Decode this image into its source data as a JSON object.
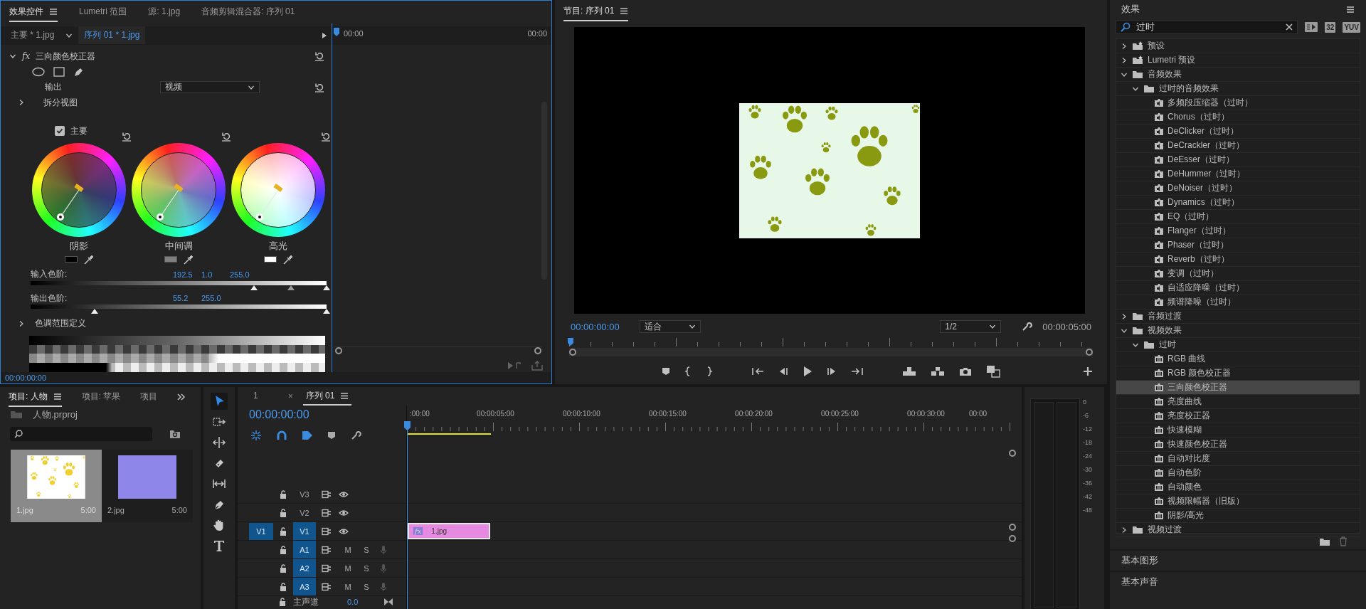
{
  "effect_controls": {
    "tabs": [
      {
        "label": "效果控件",
        "selected": true
      },
      {
        "label": "Lumetri 范围",
        "selected": false
      },
      {
        "label": "源: 1.jpg",
        "selected": false
      },
      {
        "label": "音频剪辑混合器: 序列 01",
        "selected": false
      }
    ],
    "clip_tabs": [
      {
        "label": "主要 * 1.jpg",
        "selected": false
      },
      {
        "label": "序列 01 * 1.jpg",
        "selected": true
      }
    ],
    "ruler_labels": [
      "00:00",
      "00:00"
    ],
    "effect": {
      "badge": "fx",
      "name": "三向颜色校正器",
      "expanded": true
    },
    "output": {
      "label": "输出",
      "value": "视频"
    },
    "split_view": {
      "label": "拆分视图",
      "expanded": false
    },
    "master": {
      "label": "主要",
      "checked": true
    },
    "wheels": [
      {
        "label": "阴影",
        "kind": "shadows"
      },
      {
        "label": "中间调",
        "kind": "midtones"
      },
      {
        "label": "高光",
        "kind": "highlights"
      }
    ],
    "input_levels": {
      "label": "输入色阶:",
      "values": [
        "192.5",
        "1.0",
        "255.0"
      ],
      "handles": [
        {
          "level": 0.755
        },
        {
          "level": 0.88
        },
        {
          "level": 1
        }
      ]
    },
    "output_levels": {
      "label": "输出色阶:",
      "values": [
        "55.2",
        "255.0"
      ],
      "handles": [
        {
          "level": 0.216
        },
        {
          "level": 1
        }
      ]
    },
    "tonal_range": {
      "label": "色调范围定义",
      "expanded": false
    },
    "timecode": "00:00:00:00"
  },
  "program_monitor": {
    "title": "节目: 序列 01",
    "timecode": "00:00:00:00",
    "zoom": "适合",
    "resolution": "1/2",
    "duration": "00:00:05:00"
  },
  "effects": {
    "title": "效果",
    "search": "过时",
    "badges": [
      "32",
      "YUV"
    ],
    "tree": [
      {
        "label": "预设",
        "kind": "preset_folder",
        "expanded": false,
        "selected": false
      },
      {
        "label": "Lumetri 预设",
        "kind": "preset_folder",
        "expanded": false,
        "selected": false
      },
      {
        "label": "音频效果",
        "kind": "folder",
        "expanded": true,
        "selected": false,
        "children": [
          {
            "label": "过时的音频效果",
            "kind": "folder",
            "expanded": true,
            "selected": false,
            "children": [
              {
                "label": "多频段压缩器（过时）",
                "kind": "audio_effect",
                "selected": false
              },
              {
                "label": "Chorus（过时）",
                "kind": "audio_effect",
                "selected": false
              },
              {
                "label": "DeClicker（过时）",
                "kind": "audio_effect",
                "selected": false
              },
              {
                "label": "DeCrackler（过时）",
                "kind": "audio_effect",
                "selected": false
              },
              {
                "label": "DeEsser（过时）",
                "kind": "audio_effect",
                "selected": false
              },
              {
                "label": "DeHummer（过时）",
                "kind": "audio_effect",
                "selected": false
              },
              {
                "label": "DeNoiser（过时）",
                "kind": "audio_effect",
                "selected": false
              },
              {
                "label": "Dynamics（过时）",
                "kind": "audio_effect",
                "selected": false
              },
              {
                "label": "EQ（过时）",
                "kind": "audio_effect",
                "selected": false
              },
              {
                "label": "Flanger（过时）",
                "kind": "audio_effect",
                "selected": false
              },
              {
                "label": "Phaser（过时）",
                "kind": "audio_effect",
                "selected": false
              },
              {
                "label": "Reverb（过时）",
                "kind": "audio_effect",
                "selected": false
              },
              {
                "label": "变调（过时）",
                "kind": "audio_effect",
                "selected": false
              },
              {
                "label": "自适应降噪（过时）",
                "kind": "audio_effect",
                "selected": false
              },
              {
                "label": "频谱降噪（过时）",
                "kind": "audio_effect",
                "selected": false
              }
            ]
          }
        ]
      },
      {
        "label": "音频过渡",
        "kind": "folder",
        "expanded": false,
        "selected": false
      },
      {
        "label": "视频效果",
        "kind": "folder",
        "expanded": true,
        "selected": false,
        "children": [
          {
            "label": "过时",
            "kind": "folder",
            "expanded": true,
            "selected": false,
            "children": [
              {
                "label": "RGB 曲线",
                "kind": "video_effect",
                "selected": false
              },
              {
                "label": "RGB 颜色校正器",
                "kind": "video_effect",
                "selected": false
              },
              {
                "label": "三向颜色校正器",
                "kind": "video_effect",
                "selected": true
              },
              {
                "label": "亮度曲线",
                "kind": "video_effect",
                "selected": false
              },
              {
                "label": "亮度校正器",
                "kind": "video_effect",
                "selected": false
              },
              {
                "label": "快速模糊",
                "kind": "video_effect",
                "selected": false
              },
              {
                "label": "快速颜色校正器",
                "kind": "video_effect",
                "selected": false
              },
              {
                "label": "自动对比度",
                "kind": "video_effect",
                "selected": false
              },
              {
                "label": "自动色阶",
                "kind": "video_effect",
                "selected": false
              },
              {
                "label": "自动颜色",
                "kind": "video_effect",
                "selected": false
              },
              {
                "label": "视频限幅器（旧版）",
                "kind": "video_effect",
                "selected": false
              },
              {
                "label": "阴影/高光",
                "kind": "video_effect",
                "selected": false
              }
            ]
          }
        ]
      },
      {
        "label": "视频过渡",
        "kind": "folder",
        "expanded": false,
        "selected": false
      }
    ],
    "sections": [
      "基本图形",
      "基本声音"
    ]
  },
  "project": {
    "tabs": [
      {
        "label": "项目: 人物",
        "selected": true
      },
      {
        "label": "项目: 苹果",
        "selected": false
      },
      {
        "label": "项目",
        "selected": false
      }
    ],
    "file": "人物.prproj",
    "items": [
      {
        "name": "1.jpg",
        "duration": "5:00",
        "kind": "paws",
        "selected": true
      },
      {
        "name": "2.jpg",
        "duration": "5:00",
        "kind": "solid",
        "selected": false
      }
    ]
  },
  "tools": [
    {
      "kind": "selection",
      "selected": true
    },
    {
      "kind": "track_select",
      "selected": false
    },
    {
      "kind": "ripple",
      "selected": false
    },
    {
      "kind": "razor",
      "selected": false
    },
    {
      "kind": "slip",
      "selected": false
    },
    {
      "kind": "pen",
      "selected": false
    },
    {
      "kind": "hand",
      "selected": false
    },
    {
      "kind": "type",
      "selected": false
    }
  ],
  "timeline": {
    "tabs": [
      {
        "label": "1",
        "selected": false,
        "closable": false
      },
      {
        "label": "序列 01",
        "selected": true,
        "closable": true
      }
    ],
    "close": "×",
    "timecode": "00:00:00:00",
    "ruler": [
      ":00:00",
      "00:00:05:00",
      "00:00:10:00",
      "00:00:15:00",
      "00:00:20:00",
      "00:00:25:00",
      "00:00:30:00",
      "00:00"
    ],
    "tracks": [
      {
        "name": "V3",
        "kind": "video",
        "targeted": false
      },
      {
        "name": "V2",
        "kind": "video",
        "targeted": false
      },
      {
        "name": "V1",
        "kind": "video",
        "targeted": true,
        "source": "V1"
      },
      {
        "name": "A1",
        "kind": "audio",
        "targeted": true,
        "mute": "M",
        "solo": "S"
      },
      {
        "name": "A2",
        "kind": "audio",
        "targeted": true,
        "mute": "M",
        "solo": "S"
      },
      {
        "name": "A3",
        "kind": "audio",
        "targeted": true,
        "mute": "M",
        "solo": "S"
      }
    ],
    "master": {
      "label": "主声道",
      "value": "0.0"
    },
    "clip": {
      "badge": "fx",
      "name": "1.jpg"
    }
  },
  "audio_meter": {
    "scale": [
      "0",
      "-6",
      "-12",
      "-18",
      "-24",
      "-30",
      "-36",
      "-42",
      "-48"
    ]
  }
}
